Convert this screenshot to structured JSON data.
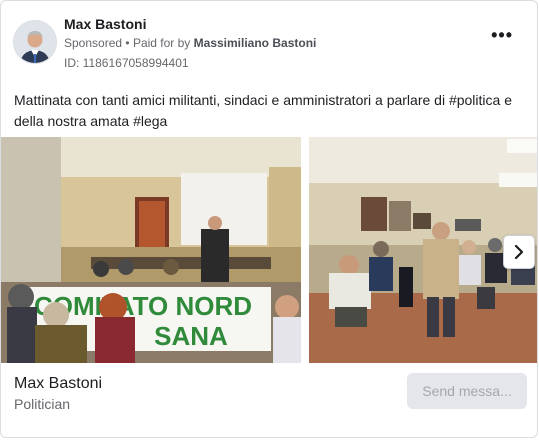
{
  "ad": {
    "advertiser_name": "Max Bastoni",
    "sponsored_label": "Sponsored",
    "paid_for_prefix": "Paid for by",
    "paid_for_name": "Massimiliano Bastoni",
    "ad_id": "ID: 1186167058994401",
    "body_text": "Mattinata con tanti amici militanti, sindaci e amministratori a parlare di #politica e della nostra amata #lega",
    "more_label": "•••"
  },
  "carousel": {
    "banner_line1": "COMITATO NORD",
    "banner_line2": "SANA"
  },
  "footer": {
    "page_name": "Max Bastoni",
    "page_category": "Politician",
    "cta_label": "Send messa..."
  },
  "colors": {
    "banner_green": "#2f8a3a",
    "cta_bg": "#e4e6eb",
    "cta_text": "#a4a7ab"
  }
}
